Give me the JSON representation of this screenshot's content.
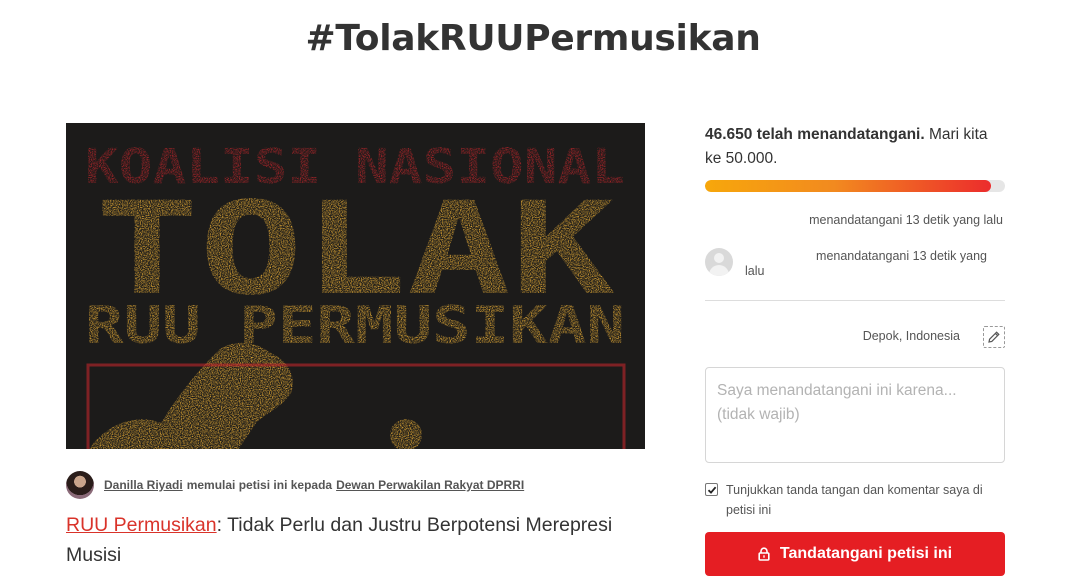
{
  "page": {
    "title": "#TolakRUUPermusikan"
  },
  "hero": {
    "line1": "KOALISI NASIONAL",
    "line2": "TOLAK",
    "line3": "RUU PERMUSIKAN",
    "colors": {
      "background": "#1c1b1a",
      "red": "#c0262b",
      "yellow": "#f2b437"
    }
  },
  "starter": {
    "name": "Danilla Riyadi",
    "middle": "memulai petisi ini kepada",
    "target": "Dewan Perwakilan Rakyat DPRRI"
  },
  "petition": {
    "link_text": "RUU Permusikan",
    "title_rest": ": Tidak Perlu dan Justru Berpotensi Merepresi Musisi"
  },
  "signatures": {
    "count_bold": "46.650 telah menandatangani.",
    "count_rest": " Mari kita ke 50.000.",
    "current": 46650,
    "goal": 50000,
    "progress_fraction": 0.9525,
    "recent_1": "menandatangani 13 detik yang lalu",
    "recent_2_line1": "menandatangani 13 detik yang",
    "recent_2_line2": "lalu"
  },
  "form": {
    "location": "Depok, Indonesia",
    "comment_placeholder": "Saya menandatangani ini karena... (tidak wajib)",
    "checkbox_label": "Tunjukkan tanda tangan dan komentar saya di petisi ini",
    "checkbox_checked": true,
    "sign_button": "Tandatangani petisi ini"
  },
  "icons": {
    "edit": "pencil-edit-icon",
    "check": "check-icon",
    "lock": "lock-icon",
    "avatar": "default-user-avatar"
  },
  "colors": {
    "accent_red": "#e51e23",
    "link_red": "#d9332a",
    "progress_start": "#f7a70b",
    "progress_end": "#ec2c2c",
    "text": "#333333"
  }
}
